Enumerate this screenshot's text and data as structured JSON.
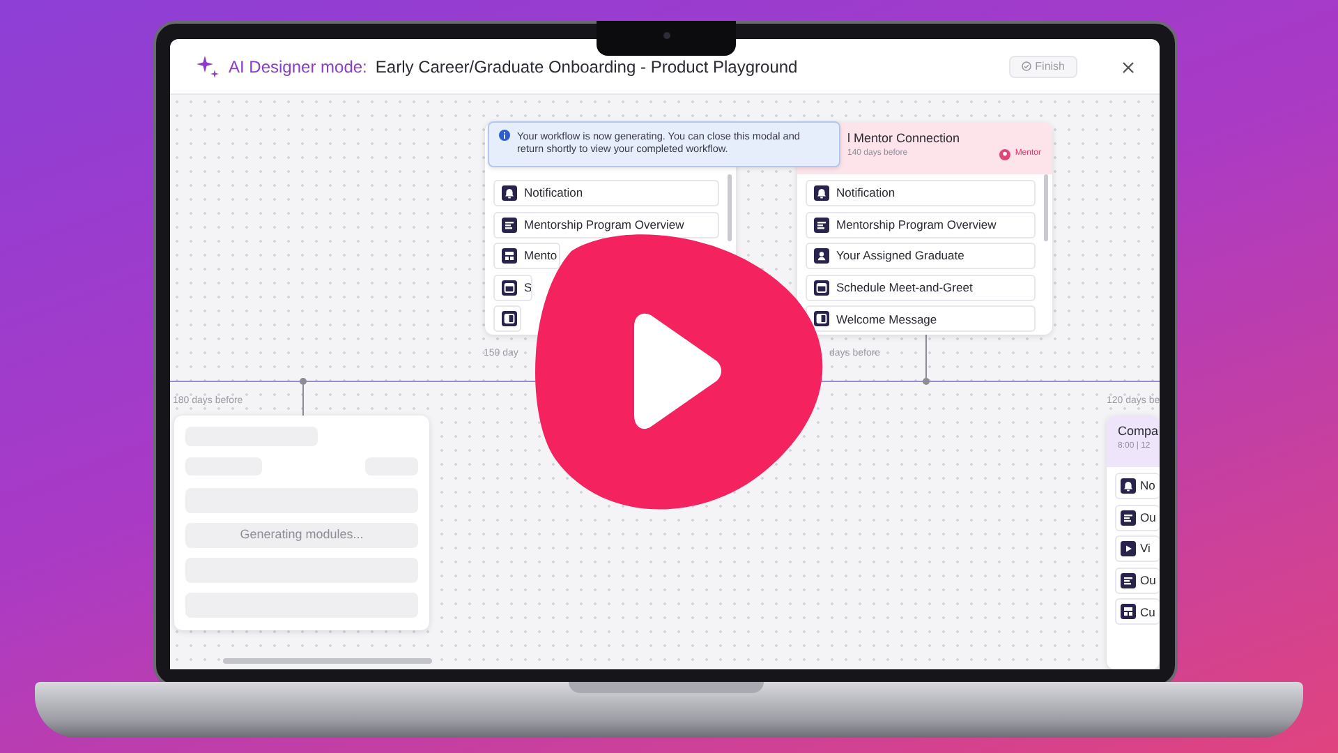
{
  "header": {
    "mode_label": "AI Designer mode:",
    "title": "Early Career/Graduate Onboarding - Product Playground",
    "finish_button": {
      "label": "Finish",
      "disabled": true
    }
  },
  "toast": {
    "text": "Your workflow is now generating. You can close this modal and return shortly to view your completed workflow."
  },
  "cards": [
    {
      "kind": "modules",
      "time_label": "150 day",
      "items": [
        {
          "label": "Notification",
          "kind": "notification"
        },
        {
          "label": "Mentorship Program Overview",
          "kind": "content"
        },
        {
          "label": "Mento",
          "kind": "form"
        },
        {
          "label": "S",
          "kind": "schedule"
        },
        {
          "kind": "message"
        }
      ]
    },
    {
      "kind": "modules",
      "time_label": "days before",
      "title": "l Mentor Connection",
      "subtitle": "140 days before",
      "color": "#fde3ea",
      "tag": {
        "label": "Mentor"
      },
      "items": [
        {
          "label": "Notification",
          "kind": "notification"
        },
        {
          "label": "Mentorship Program Overview",
          "kind": "content"
        },
        {
          "label": "Your Assigned Graduate",
          "kind": "profile"
        },
        {
          "label": "Schedule Meet-and-Greet",
          "kind": "schedule"
        },
        {
          "label": "Welcome Message",
          "kind": "message"
        }
      ]
    },
    {
      "kind": "loading",
      "time_label": "180 days before",
      "status": "Generating modules..."
    },
    {
      "kind": "modules",
      "time_label": "120 days be",
      "title": "Compa",
      "subtitle": "8:00 | 12",
      "color": "#efe5fb",
      "items": [
        {
          "label": "No",
          "kind": "notification"
        },
        {
          "label": "Ou",
          "kind": "content"
        },
        {
          "label": "Vi",
          "kind": "video"
        },
        {
          "label": "Ou",
          "kind": "content"
        },
        {
          "label": "Cu",
          "kind": "form"
        }
      ]
    }
  ]
}
